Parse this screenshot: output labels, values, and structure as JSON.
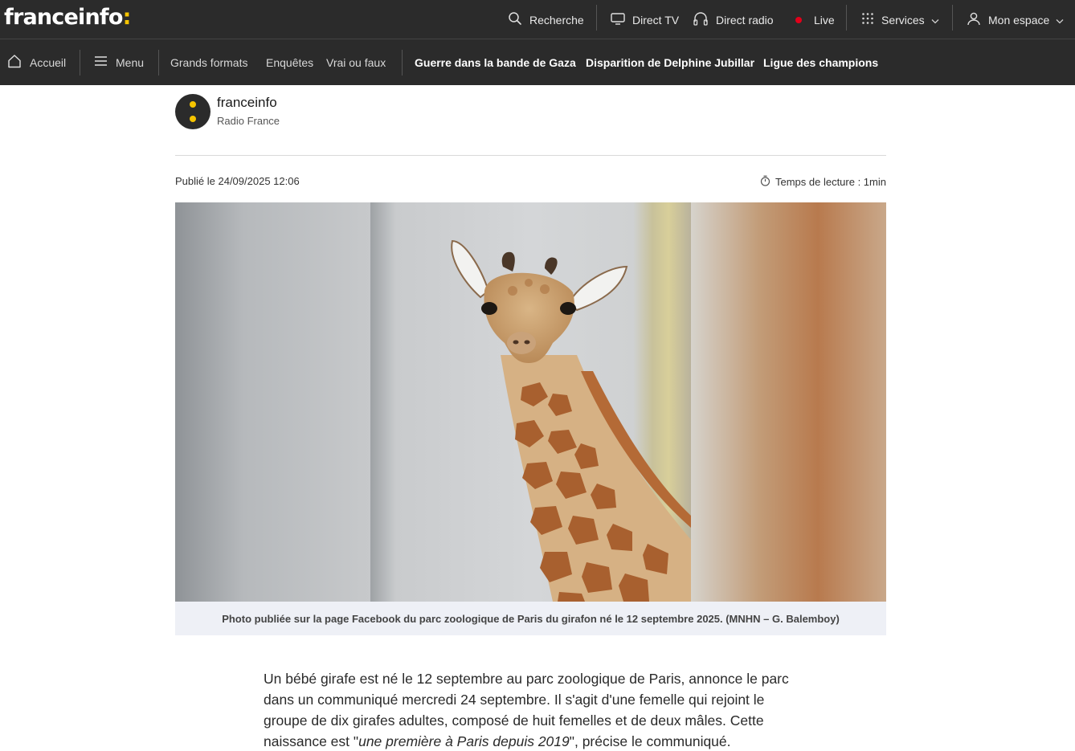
{
  "header": {
    "logo_text": "franceinfo",
    "logo_colon": ":",
    "nav": {
      "search": "Recherche",
      "direct_tv": "Direct TV",
      "direct_radio": "Direct radio",
      "live": "Live",
      "services": "Services",
      "account": "Mon espace"
    }
  },
  "navbar": {
    "home": "Accueil",
    "menu": "Menu",
    "items": [
      "Grands formats",
      "Enquêtes",
      "Vrai ou faux"
    ],
    "topics": [
      "Guerre dans la bande de Gaza",
      "Disparition de Delphine Jubillar",
      "Ligue des champions"
    ]
  },
  "source": {
    "name": "franceinfo",
    "org": "Radio France"
  },
  "meta": {
    "published": "Publié le 24/09/2025 12:06",
    "reading_time": "Temps de lecture : 1min"
  },
  "photo": {
    "caption": "Photo publiée sur la page Facebook du parc zoologique de Paris du girafon né le 12 septembre 2025. (MNHN – G. Balemboy)"
  },
  "article": {
    "p1_before": "Un bébé girafe est né le 12 septembre au parc zoologique de Paris, annonce le parc dans un communiqué mercredi 24 septembre. Il s'agit d'une femelle qui rejoint le groupe de dix girafes adultes, composé de huit femelles et de deux mâles. Cette naissance est \"",
    "p1_quote": "une première à Paris depuis 2019",
    "p1_after": "\", précise le communiqué."
  },
  "colors": {
    "bar_bg": "#2b2b2b",
    "brand_yellow": "#f6c400",
    "live_red": "#e2001a",
    "caption_bg": "#eef0f6"
  },
  "icons": [
    "search-icon",
    "tv-icon",
    "headphones-icon",
    "live-dot-icon",
    "grid-icon",
    "chevron-down-icon",
    "user-icon",
    "home-icon",
    "menu-icon",
    "timer-icon"
  ]
}
